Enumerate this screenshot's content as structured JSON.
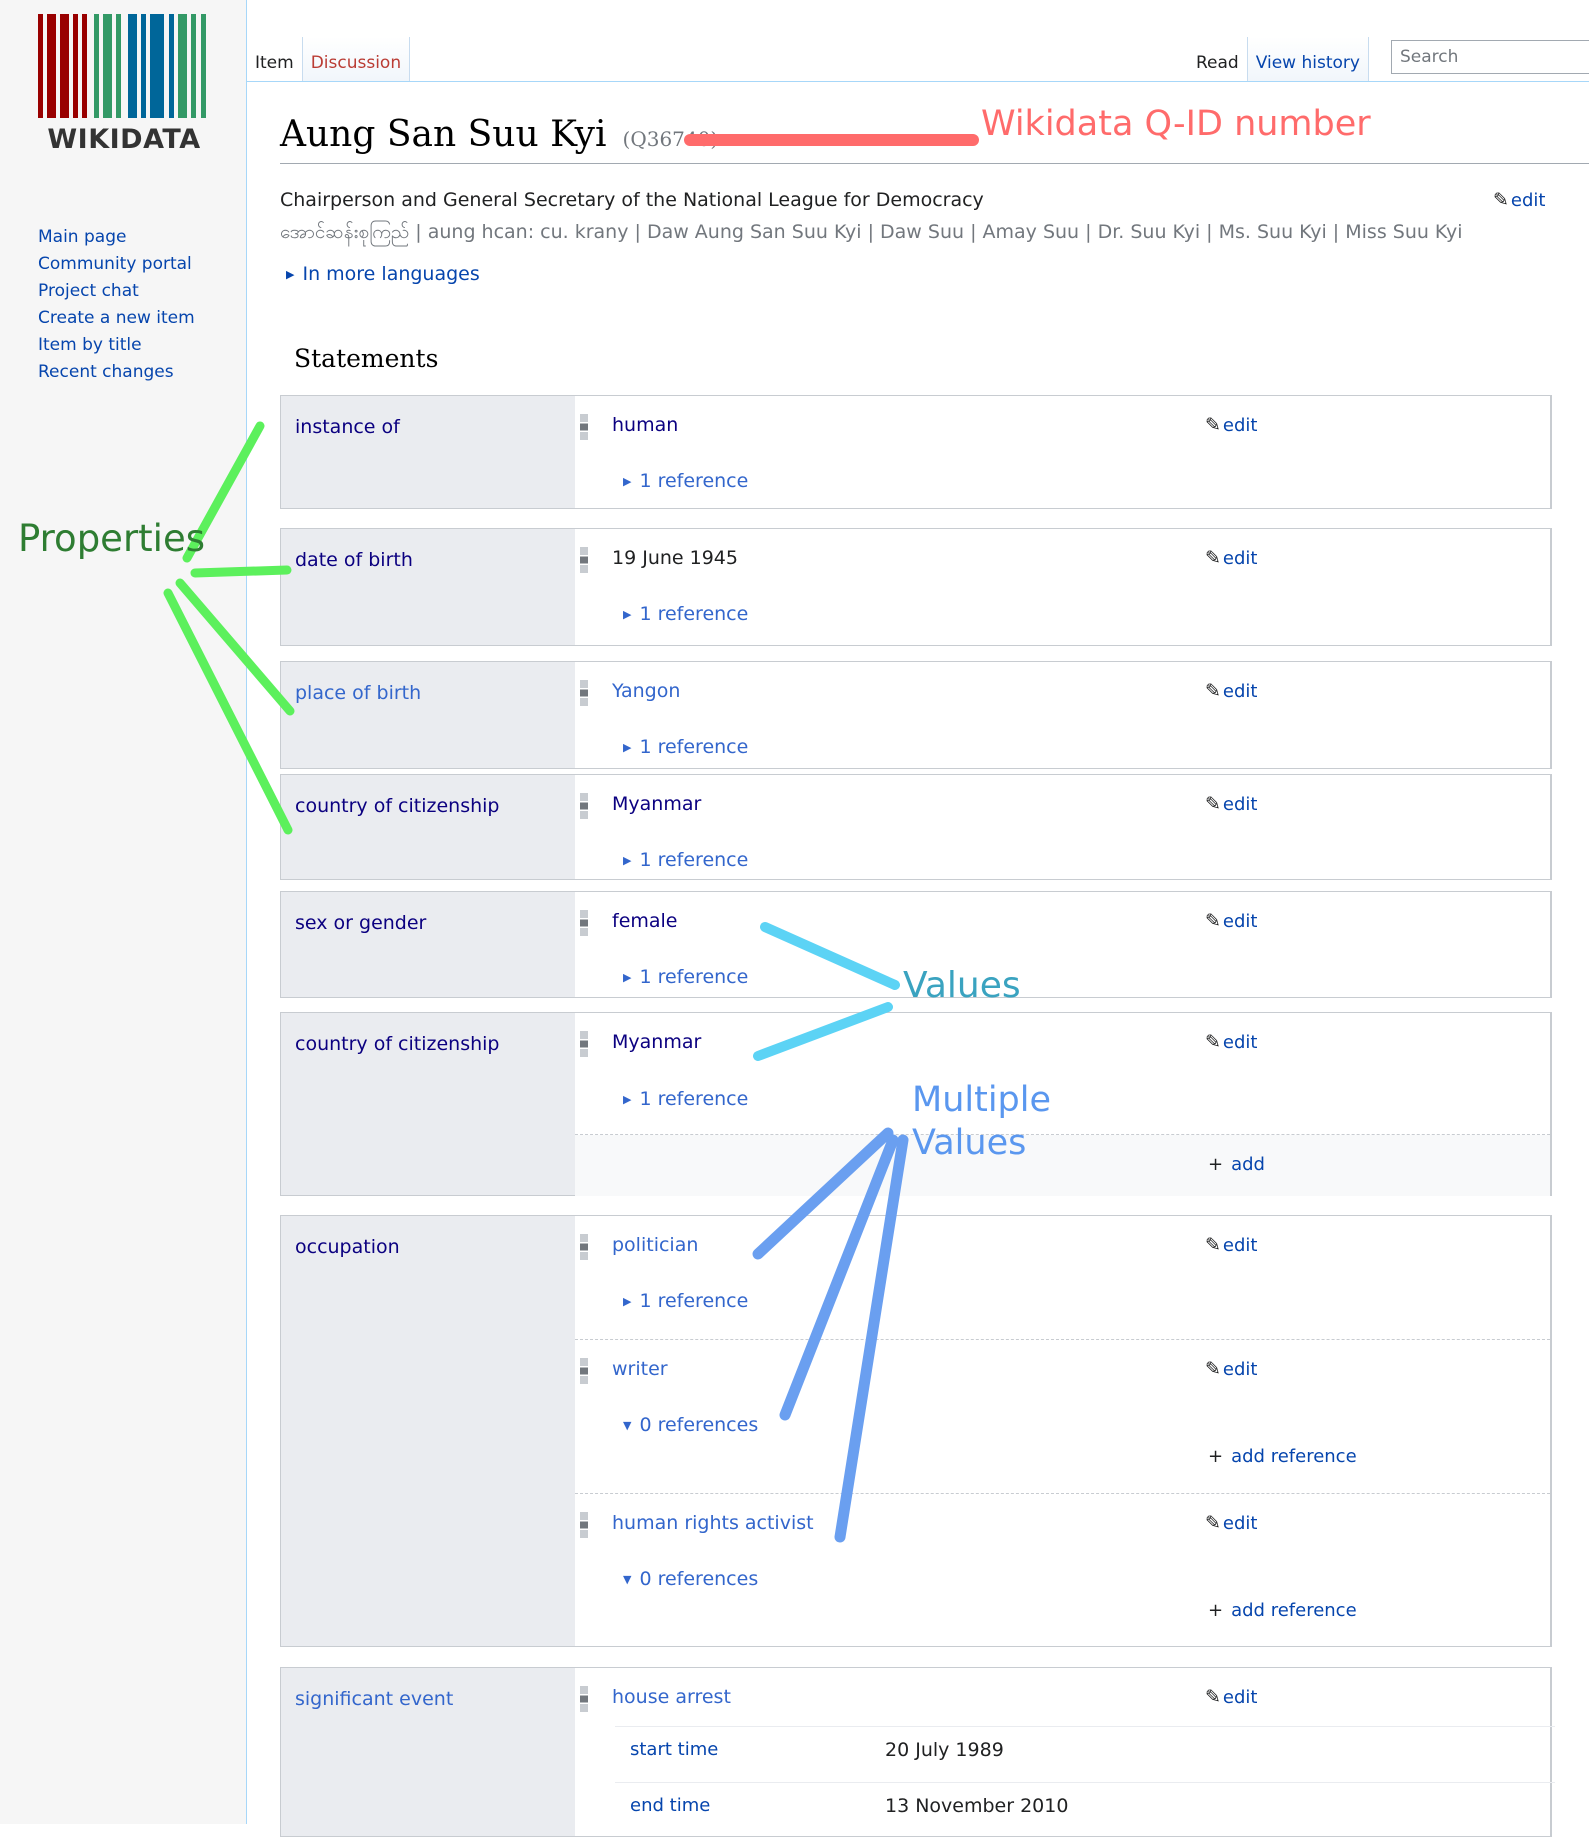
{
  "logo": {
    "wordmark": "WIKIDATA"
  },
  "sidebar": {
    "items": [
      {
        "label": "Main page"
      },
      {
        "label": "Community portal"
      },
      {
        "label": "Project chat"
      },
      {
        "label": "Create a new item"
      },
      {
        "label": "Item by title"
      },
      {
        "label": "Recent changes"
      }
    ]
  },
  "tabs": {
    "left": [
      {
        "label": "Item"
      },
      {
        "label": "Discussion"
      }
    ],
    "right": [
      {
        "label": "Read"
      },
      {
        "label": "View history"
      }
    ]
  },
  "search": {
    "placeholder": "Search"
  },
  "item": {
    "title": "Aung San Suu Kyi",
    "qid": "(Q36740)",
    "description": "Chairperson and General Secretary of the National League for Democracy",
    "aliases": "အောင်ဆန်းစုကြည် | aung hcan: cu. krany | Daw Aung San Suu Kyi | Daw Suu | Amay Suu | Dr. Suu Kyi | Ms. Suu Kyi | Miss Suu Kyi",
    "edit_label": "edit",
    "more_languages": "In more languages"
  },
  "statements": {
    "heading": "Statements",
    "edit_label": "edit",
    "add_label": "add",
    "add_reference_label": "add reference",
    "groups": [
      {
        "property": "instance of",
        "values": [
          {
            "value": "human",
            "references": "1 reference"
          }
        ]
      },
      {
        "property": "date of birth",
        "values": [
          {
            "value": "19 June 1945",
            "references": "1 reference"
          }
        ]
      },
      {
        "property": "place of birth",
        "values": [
          {
            "value": "Yangon",
            "references": "1 reference"
          }
        ]
      },
      {
        "property": "country of citizenship",
        "values": [
          {
            "value": "Myanmar",
            "references": "1 reference"
          }
        ]
      },
      {
        "property": "sex or gender",
        "values": [
          {
            "value": "female",
            "references": "1 reference"
          }
        ]
      },
      {
        "property": "country of citizenship",
        "values": [
          {
            "value": "Myanmar",
            "references": "1 reference"
          }
        ]
      },
      {
        "property": "occupation",
        "values": [
          {
            "value": "politician",
            "references": "1 reference"
          },
          {
            "value": "writer",
            "references": "0 references"
          },
          {
            "value": "human rights activist",
            "references": "0 references"
          }
        ]
      },
      {
        "property": "significant event",
        "values": [
          {
            "value": "house arrest",
            "qualifiers": [
              {
                "property": "start time",
                "value": "20 July 1989"
              },
              {
                "property": "end time",
                "value": "13 November 2010"
              }
            ]
          }
        ]
      }
    ]
  },
  "annotations": {
    "qid_label": "Wikidata Q-ID number",
    "properties_label": "Properties",
    "values_label": "Values",
    "multiple_values_line1": "Multiple",
    "multiple_values_line2": "Values",
    "colors": {
      "qid": "#ff6b6b",
      "properties": "#5cf05c",
      "properties_text": "#2e7d32",
      "values": "#5cd3f5",
      "values_text": "#3aa3c0",
      "multiple": "#6a9ff0",
      "multiple_text": "#5a97ef"
    }
  }
}
